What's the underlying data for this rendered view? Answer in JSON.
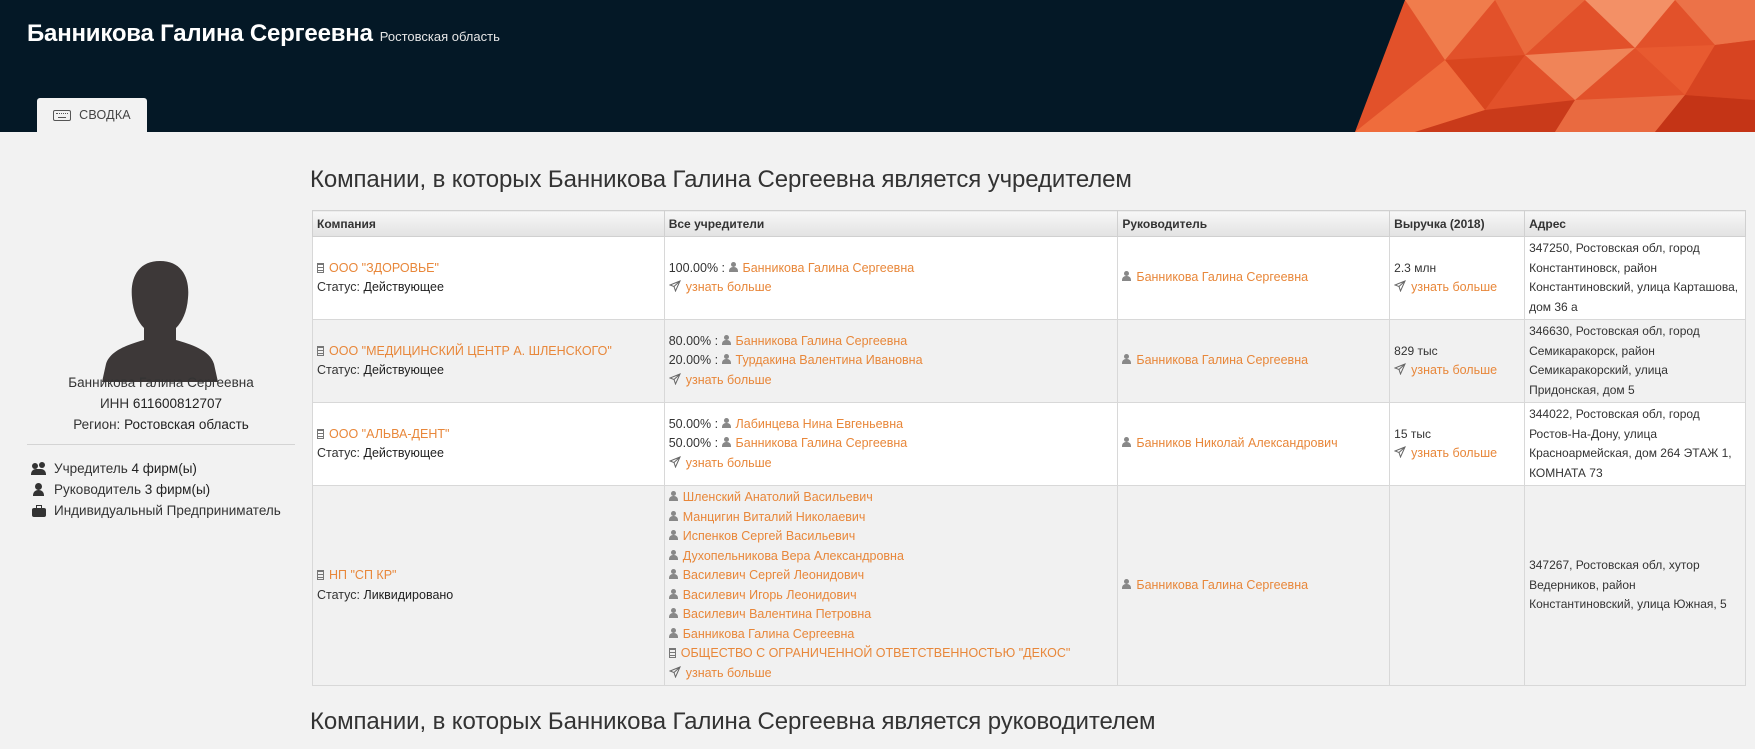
{
  "header": {
    "person_name": "Банникова Галина Сергеевна",
    "region": "Ростовская область",
    "tab_label": "СВОДКА",
    "accent_color": "#e8873a"
  },
  "sidebar": {
    "name": "Банникова Галина Сергеевна",
    "inn_label": "ИНН",
    "inn_value": "611600812707",
    "region_label": "Регион:",
    "region_value": "Ростовская область",
    "items": [
      {
        "icon": "users-icon",
        "label": "Учредитель",
        "value": "4 фирм(ы)"
      },
      {
        "icon": "user-icon",
        "label": "Руководитель",
        "value": "3 фирм(ы)"
      },
      {
        "icon": "briefcase-icon",
        "label": "Индивидуальный Предприниматель",
        "value": ""
      }
    ]
  },
  "section1_title": "Компании, в которых Банникова Галина Сергеевна является учредителем",
  "section2_title": "Компании, в которых Банникова Галина Сергеевна является руководителем",
  "table": {
    "columns": [
      "Компания",
      "Все учредители",
      "Руководитель",
      "Выручка (2018)",
      "Адрес"
    ],
    "status_label": "Статус:",
    "more_label": "узнать больше",
    "rows": [
      {
        "company": "ООО \"ЗДОРОВЬЕ\"",
        "status": "Действующее",
        "founders": [
          {
            "pct": "100.00% :",
            "name": "Банникова Галина Сергеевна"
          }
        ],
        "director": "Банникова Галина Сергеевна",
        "revenue": "2.3 млн",
        "address": "347250, Ростовская обл, город Константиновск, район Константиновский, улица Карташова, дом 36 а"
      },
      {
        "company": "ООО \"МЕДИЦИНСКИЙ ЦЕНТР А. ШЛЕНСКОГО\"",
        "status": "Действующее",
        "founders": [
          {
            "pct": "80.00% :",
            "name": "Банникова Галина Сергеевна"
          },
          {
            "pct": "20.00% :",
            "name": "Турдакина Валентина Ивановна"
          }
        ],
        "director": "Банникова Галина Сергеевна",
        "revenue": "829 тыс",
        "address": "346630, Ростовская обл, город Семикаракорск, район Семикаракорский, улица Придонская, дом 5"
      },
      {
        "company": "ООО \"АЛЬВА-ДЕНТ\"",
        "status": "Действующее",
        "founders": [
          {
            "pct": "50.00% :",
            "name": "Лабинцева Нина Евгеньевна"
          },
          {
            "pct": "50.00% :",
            "name": "Банникова Галина Сергеевна"
          }
        ],
        "director": "Банников Николай Александрович",
        "revenue": "15 тыс",
        "address": "344022, Ростовская обл, город Ростов-На-Дону, улица Красноармейская, дом 264 ЭТАЖ 1, КОМНАТА 73"
      },
      {
        "company": "НП \"СП КР\"",
        "status": "Ликвидировано",
        "founders": [
          {
            "pct": "",
            "name": "Шленский Анатолий Васильевич"
          },
          {
            "pct": "",
            "name": "Манцигин Виталий Николаевич"
          },
          {
            "pct": "",
            "name": "Испенков Сергей Васильевич"
          },
          {
            "pct": "",
            "name": "Духопельникова Вера Александровна"
          },
          {
            "pct": "",
            "name": "Василевич Сергей Леонидович"
          },
          {
            "pct": "",
            "name": "Василевич Игорь Леонидович"
          },
          {
            "pct": "",
            "name": "Василевич Валентина Петровна"
          },
          {
            "pct": "",
            "name": "Банникова Галина Сергеевна"
          },
          {
            "pct": "",
            "name": "ОБЩЕСТВО С ОГРАНИЧЕННОЙ ОТВЕТСТВЕННОСТЬЮ \"ДЕКОС\"",
            "org": true
          }
        ],
        "director": "Банникова Галина Сергеевна",
        "revenue": "",
        "address": "347267, Ростовская обл, хутор Ведерников, район Константиновский, улица Южная, 5"
      }
    ]
  }
}
